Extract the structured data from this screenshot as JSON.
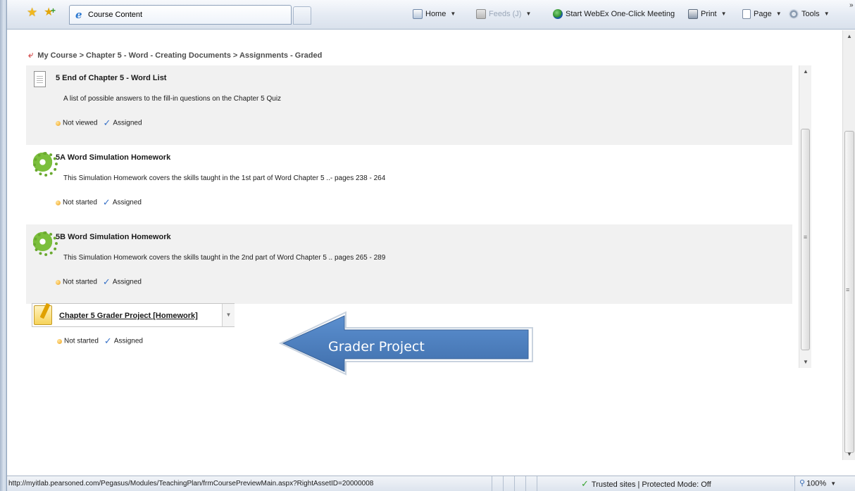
{
  "browser": {
    "tab_title": "Course Content",
    "commands": {
      "home": "Home",
      "feeds": "Feeds (J)",
      "webex": "Start WebEx One-Click Meeting",
      "print": "Print",
      "page": "Page",
      "tools": "Tools"
    },
    "chevrons": "»"
  },
  "breadcrumb": {
    "text": "My Course > Chapter 5 - Word - Creating Documents > Assignments - Graded"
  },
  "items": [
    {
      "title": "5 End of Chapter 5 - Word List",
      "description": "A list of possible answers to the fill-in questions on the Chapter 5 Quiz",
      "status": "Not viewed",
      "assignment": "Assigned"
    },
    {
      "title": "5A Word Simulation Homework",
      "description": "This Simulation Homework covers the skills taught in the 1st part of Word Chapter 5 ..- pages 238 - 264",
      "status": "Not started",
      "assignment": "Assigned"
    },
    {
      "title": "5B Word Simulation Homework",
      "description": "This Simulation Homework covers the skills taught in the 2nd part of Word Chapter 5 .. pages 265 - 289",
      "status": "Not started",
      "assignment": "Assigned"
    }
  ],
  "grader_project": {
    "title": "Chapter 5 Grader Project [Homework]",
    "status": "Not started",
    "assignment": "Assigned"
  },
  "callout": {
    "label": "Grader Project",
    "color": "#4f81bd"
  },
  "statusbar": {
    "url": "http://myitlab.pearsoned.com/Pegasus/Modules/TeachingPlan/frmCoursePreviewMain.aspx?RightAssetID=20000008",
    "zone": "Trusted sites | Protected Mode: Off",
    "zoom": "100%"
  }
}
